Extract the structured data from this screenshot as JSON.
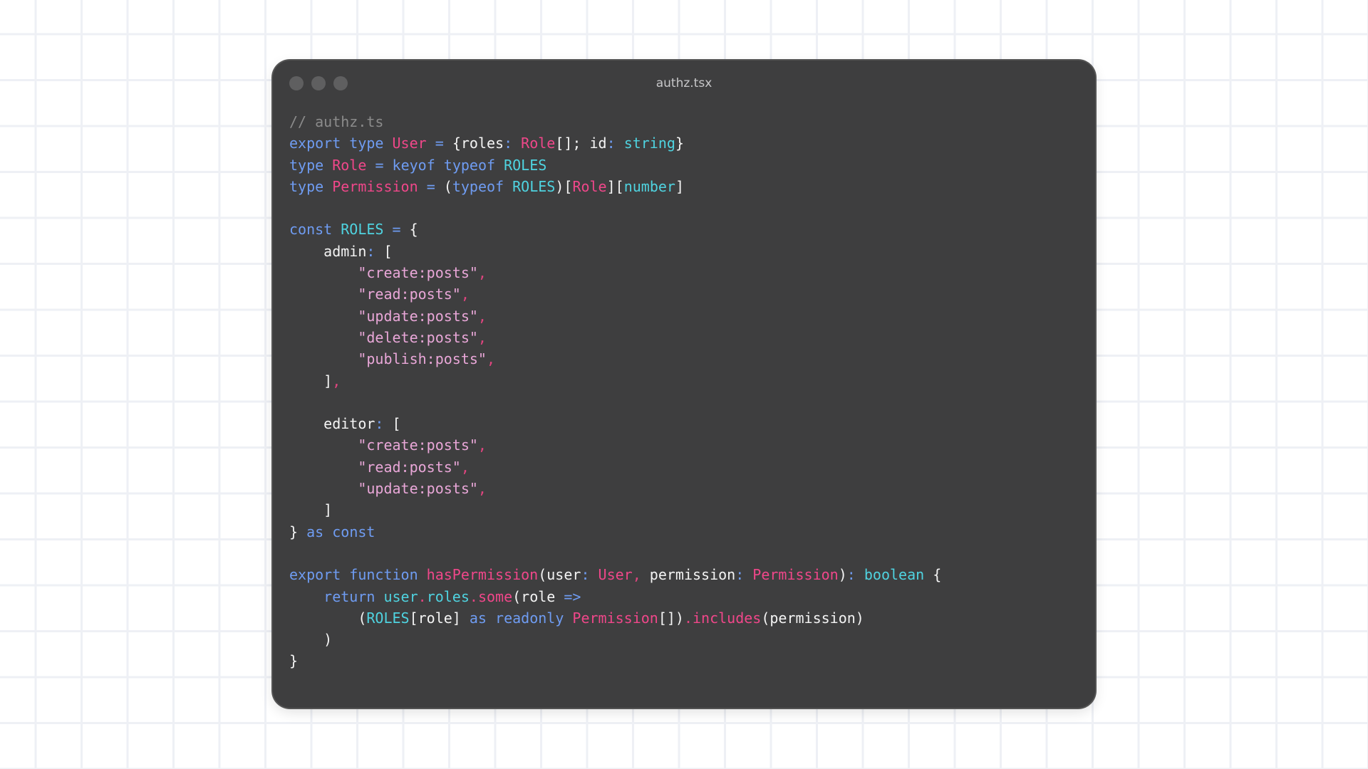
{
  "window": {
    "title": "authz.tsx"
  },
  "colors": {
    "background": "#ffffff",
    "window_bg": "#3e3e3f",
    "comment": "#8b8b8b",
    "keyword": "#6f9cf2",
    "type": "#f0478a",
    "constant": "#4fd3e0",
    "operator": "#e0457f",
    "string": "#e9a7d8",
    "plain": "#f4f4f4"
  },
  "code": {
    "lines": [
      [
        {
          "t": "// authz.ts",
          "k": "cm"
        }
      ],
      [
        {
          "t": "export",
          "k": "kw"
        },
        {
          "t": " ",
          "k": "pl"
        },
        {
          "t": "type",
          "k": "kw"
        },
        {
          "t": " ",
          "k": "pl"
        },
        {
          "t": "User",
          "k": "ty"
        },
        {
          "t": " ",
          "k": "pl"
        },
        {
          "t": "=",
          "k": "kw"
        },
        {
          "t": " {roles",
          "k": "pl"
        },
        {
          "t": ":",
          "k": "kw"
        },
        {
          "t": " ",
          "k": "pl"
        },
        {
          "t": "Role",
          "k": "ty"
        },
        {
          "t": "[]; id",
          "k": "pl"
        },
        {
          "t": ":",
          "k": "kw"
        },
        {
          "t": " ",
          "k": "pl"
        },
        {
          "t": "string",
          "k": "cn"
        },
        {
          "t": "}",
          "k": "pl"
        }
      ],
      [
        {
          "t": "type",
          "k": "kw"
        },
        {
          "t": " ",
          "k": "pl"
        },
        {
          "t": "Role",
          "k": "ty"
        },
        {
          "t": " ",
          "k": "pl"
        },
        {
          "t": "=",
          "k": "kw"
        },
        {
          "t": " ",
          "k": "pl"
        },
        {
          "t": "keyof",
          "k": "kw"
        },
        {
          "t": " ",
          "k": "pl"
        },
        {
          "t": "typeof",
          "k": "kw"
        },
        {
          "t": " ",
          "k": "pl"
        },
        {
          "t": "ROLES",
          "k": "cn"
        }
      ],
      [
        {
          "t": "type",
          "k": "kw"
        },
        {
          "t": " ",
          "k": "pl"
        },
        {
          "t": "Permission",
          "k": "ty"
        },
        {
          "t": " ",
          "k": "pl"
        },
        {
          "t": "=",
          "k": "kw"
        },
        {
          "t": " (",
          "k": "pl"
        },
        {
          "t": "typeof",
          "k": "kw"
        },
        {
          "t": " ",
          "k": "pl"
        },
        {
          "t": "ROLES",
          "k": "cn"
        },
        {
          "t": ")[",
          "k": "pl"
        },
        {
          "t": "Role",
          "k": "ty"
        },
        {
          "t": "][",
          "k": "pl"
        },
        {
          "t": "number",
          "k": "cn"
        },
        {
          "t": "]",
          "k": "pl"
        }
      ],
      [],
      [
        {
          "t": "const",
          "k": "kw"
        },
        {
          "t": " ",
          "k": "pl"
        },
        {
          "t": "ROLES",
          "k": "cn"
        },
        {
          "t": " ",
          "k": "pl"
        },
        {
          "t": "=",
          "k": "kw"
        },
        {
          "t": " {",
          "k": "pl"
        }
      ],
      [
        {
          "t": "    admin",
          "k": "pl"
        },
        {
          "t": ":",
          "k": "kw"
        },
        {
          "t": " [",
          "k": "pl"
        }
      ],
      [
        {
          "t": "        ",
          "k": "pl"
        },
        {
          "t": "\"create:posts\"",
          "k": "st"
        },
        {
          "t": ",",
          "k": "op"
        }
      ],
      [
        {
          "t": "        ",
          "k": "pl"
        },
        {
          "t": "\"read:posts\"",
          "k": "st"
        },
        {
          "t": ",",
          "k": "op"
        }
      ],
      [
        {
          "t": "        ",
          "k": "pl"
        },
        {
          "t": "\"update:posts\"",
          "k": "st"
        },
        {
          "t": ",",
          "k": "op"
        }
      ],
      [
        {
          "t": "        ",
          "k": "pl"
        },
        {
          "t": "\"delete:posts\"",
          "k": "st"
        },
        {
          "t": ",",
          "k": "op"
        }
      ],
      [
        {
          "t": "        ",
          "k": "pl"
        },
        {
          "t": "\"publish:posts\"",
          "k": "st"
        },
        {
          "t": ",",
          "k": "op"
        }
      ],
      [
        {
          "t": "    ]",
          "k": "pl"
        },
        {
          "t": ",",
          "k": "op"
        }
      ],
      [],
      [
        {
          "t": "    editor",
          "k": "pl"
        },
        {
          "t": ":",
          "k": "kw"
        },
        {
          "t": " [",
          "k": "pl"
        }
      ],
      [
        {
          "t": "        ",
          "k": "pl"
        },
        {
          "t": "\"create:posts\"",
          "k": "st"
        },
        {
          "t": ",",
          "k": "op"
        }
      ],
      [
        {
          "t": "        ",
          "k": "pl"
        },
        {
          "t": "\"read:posts\"",
          "k": "st"
        },
        {
          "t": ",",
          "k": "op"
        }
      ],
      [
        {
          "t": "        ",
          "k": "pl"
        },
        {
          "t": "\"update:posts\"",
          "k": "st"
        },
        {
          "t": ",",
          "k": "op"
        }
      ],
      [
        {
          "t": "    ]",
          "k": "pl"
        }
      ],
      [
        {
          "t": "} ",
          "k": "pl"
        },
        {
          "t": "as",
          "k": "kw"
        },
        {
          "t": " ",
          "k": "pl"
        },
        {
          "t": "const",
          "k": "kw"
        }
      ],
      [],
      [
        {
          "t": "export",
          "k": "kw"
        },
        {
          "t": " ",
          "k": "pl"
        },
        {
          "t": "function",
          "k": "kw"
        },
        {
          "t": " ",
          "k": "pl"
        },
        {
          "t": "hasPermission",
          "k": "fn"
        },
        {
          "t": "(user",
          "k": "pl"
        },
        {
          "t": ":",
          "k": "kw"
        },
        {
          "t": " ",
          "k": "pl"
        },
        {
          "t": "User",
          "k": "ty"
        },
        {
          "t": ",",
          "k": "op"
        },
        {
          "t": " permission",
          "k": "pl"
        },
        {
          "t": ":",
          "k": "kw"
        },
        {
          "t": " ",
          "k": "pl"
        },
        {
          "t": "Permission",
          "k": "ty"
        },
        {
          "t": ")",
          "k": "pl"
        },
        {
          "t": ":",
          "k": "kw"
        },
        {
          "t": " ",
          "k": "pl"
        },
        {
          "t": "boolean",
          "k": "cn"
        },
        {
          "t": " {",
          "k": "pl"
        }
      ],
      [
        {
          "t": "    ",
          "k": "pl"
        },
        {
          "t": "return",
          "k": "kw"
        },
        {
          "t": " ",
          "k": "pl"
        },
        {
          "t": "user",
          "k": "cn"
        },
        {
          "t": ".",
          "k": "op"
        },
        {
          "t": "roles",
          "k": "cn"
        },
        {
          "t": ".",
          "k": "op"
        },
        {
          "t": "some",
          "k": "fn"
        },
        {
          "t": "(role ",
          "k": "pl"
        },
        {
          "t": "=>",
          "k": "kw"
        }
      ],
      [
        {
          "t": "        (",
          "k": "pl"
        },
        {
          "t": "ROLES",
          "k": "cn"
        },
        {
          "t": "[role] ",
          "k": "pl"
        },
        {
          "t": "as",
          "k": "kw"
        },
        {
          "t": " ",
          "k": "pl"
        },
        {
          "t": "readonly",
          "k": "kw"
        },
        {
          "t": " ",
          "k": "pl"
        },
        {
          "t": "Permission",
          "k": "ty"
        },
        {
          "t": "[])",
          "k": "pl"
        },
        {
          "t": ".",
          "k": "op"
        },
        {
          "t": "includes",
          "k": "fn"
        },
        {
          "t": "(permission)",
          "k": "pl"
        }
      ],
      [
        {
          "t": "    )",
          "k": "pl"
        }
      ],
      [
        {
          "t": "}",
          "k": "pl"
        }
      ]
    ]
  }
}
